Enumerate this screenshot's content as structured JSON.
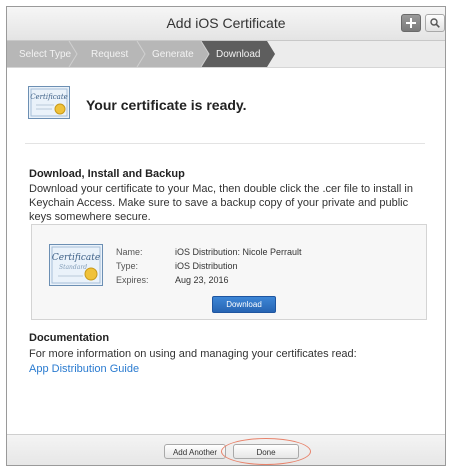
{
  "window": {
    "title": "Add iOS Certificate",
    "add_icon": "plus-icon",
    "search_icon": "search-icon"
  },
  "steps": [
    {
      "label": "Select Type",
      "state": "completed"
    },
    {
      "label": "Request",
      "state": "completed"
    },
    {
      "label": "Generate",
      "state": "completed"
    },
    {
      "label": "Download",
      "state": "current"
    }
  ],
  "ready": {
    "icon": "certificate-icon",
    "message": "Your certificate is ready."
  },
  "download_section": {
    "title": "Download, Install and Backup",
    "description": "Download your certificate to your Mac, then double click the .cer file to install in Keychain Access. Make sure to save a backup copy of your private and public keys somewhere secure."
  },
  "certificate": {
    "badge_title": "Certificate",
    "badge_subtitle": "Standard",
    "name_label": "Name:",
    "name_value": "iOS Distribution: Nicole Perrault",
    "type_label": "Type:",
    "type_value": "iOS Distribution",
    "expires_label": "Expires:",
    "expires_value": "Aug 23, 2016",
    "download_label": "Download"
  },
  "documentation": {
    "title": "Documentation",
    "description": "For more information on using and managing your certificates read:",
    "link_label": "App Distribution Guide"
  },
  "footer": {
    "add_another_label": "Add Another",
    "done_label": "Done"
  },
  "colors": {
    "accent_blue": "#2a7bd0",
    "steps_completed": "#b7b7b7",
    "steps_current": "#5e5e5e",
    "highlight": "#e8826a"
  }
}
